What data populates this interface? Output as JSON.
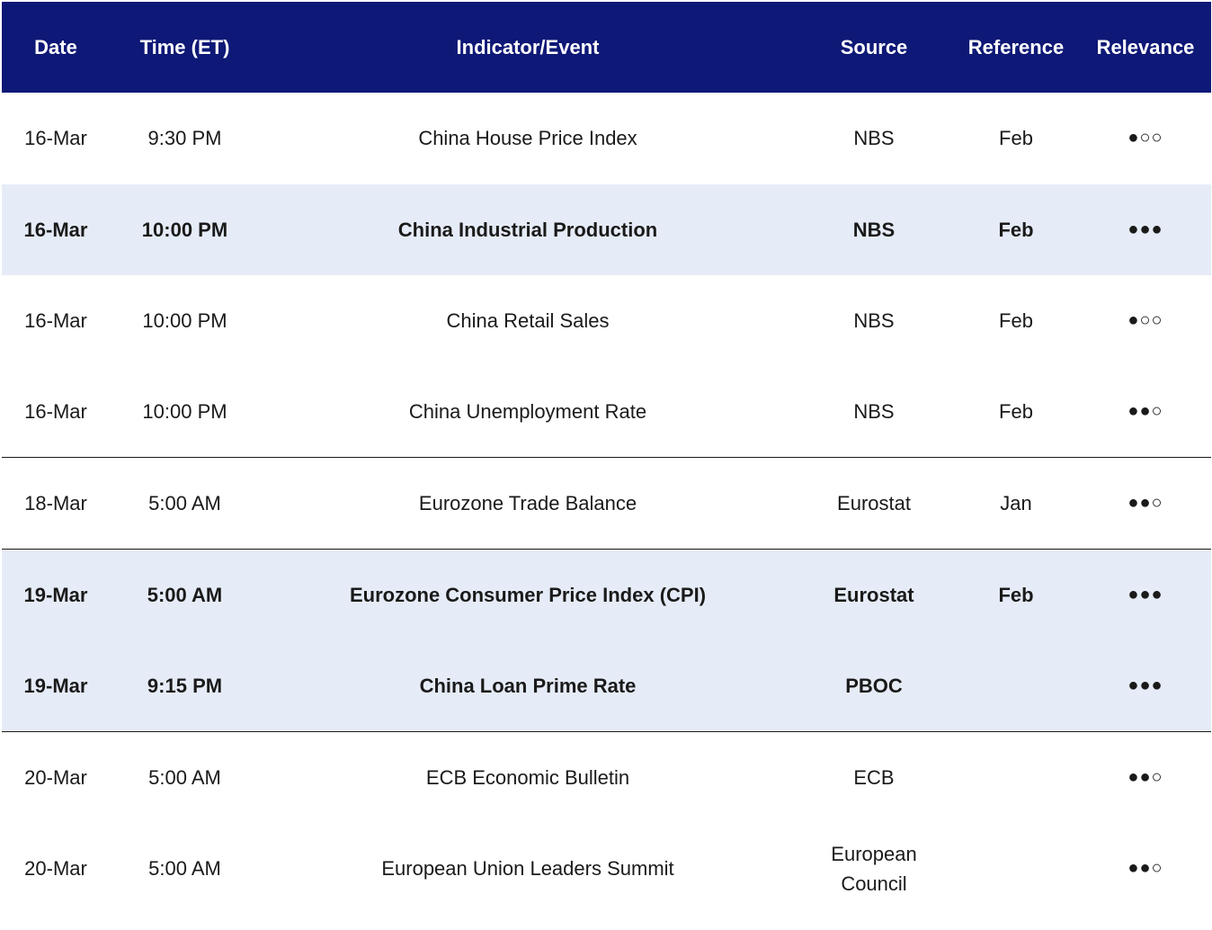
{
  "table": {
    "headers": {
      "date": "Date",
      "time": "Time (ET)",
      "event": "Indicator/Event",
      "source": "Source",
      "reference": "Reference",
      "relevance": "Relevance"
    },
    "rows": [
      {
        "date": "16-Mar",
        "time": "9:30 PM",
        "event": "China House Price Index",
        "source": "NBS",
        "reference": "Feb",
        "relevance": "●○○",
        "highlighted": false,
        "section_end": false
      },
      {
        "date": "16-Mar",
        "time": "10:00 PM",
        "event": "China Industrial Production",
        "source": "NBS",
        "reference": "Feb",
        "relevance": "●●●",
        "highlighted": true,
        "section_end": false
      },
      {
        "date": "16-Mar",
        "time": "10:00 PM",
        "event": "China Retail Sales",
        "source": "NBS",
        "reference": "Feb",
        "relevance": "●○○",
        "highlighted": false,
        "section_end": false
      },
      {
        "date": "16-Mar",
        "time": "10:00 PM",
        "event": "China Unemployment Rate",
        "source": "NBS",
        "reference": "Feb",
        "relevance": "●●○",
        "highlighted": false,
        "section_end": true
      },
      {
        "date": "18-Mar",
        "time": "5:00 AM",
        "event": "Eurozone Trade Balance",
        "source": "Eurostat",
        "reference": "Jan",
        "relevance": "●●○",
        "highlighted": false,
        "section_end": true
      },
      {
        "date": "19-Mar",
        "time": "5:00 AM",
        "event": "Eurozone Consumer Price Index (CPI)",
        "source": "Eurostat",
        "reference": "Feb",
        "relevance": "●●●",
        "highlighted": true,
        "section_end": false
      },
      {
        "date": "19-Mar",
        "time": "9:15 PM",
        "event": "China Loan Prime Rate",
        "source": "PBOC",
        "reference": "",
        "relevance": "●●●",
        "highlighted": true,
        "section_end": true
      },
      {
        "date": "20-Mar",
        "time": "5:00 AM",
        "event": "ECB Economic Bulletin",
        "source": "ECB",
        "reference": "",
        "relevance": "●●○",
        "highlighted": false,
        "section_end": false
      },
      {
        "date": "20-Mar",
        "time": "5:00 AM",
        "event": "European Union Leaders Summit",
        "source": "European\nCouncil",
        "reference": "",
        "relevance": "●●○",
        "highlighted": false,
        "section_end": false
      }
    ]
  },
  "colors": {
    "header_bg": "#0e1876",
    "highlight_bg": "#e6ecf7"
  }
}
